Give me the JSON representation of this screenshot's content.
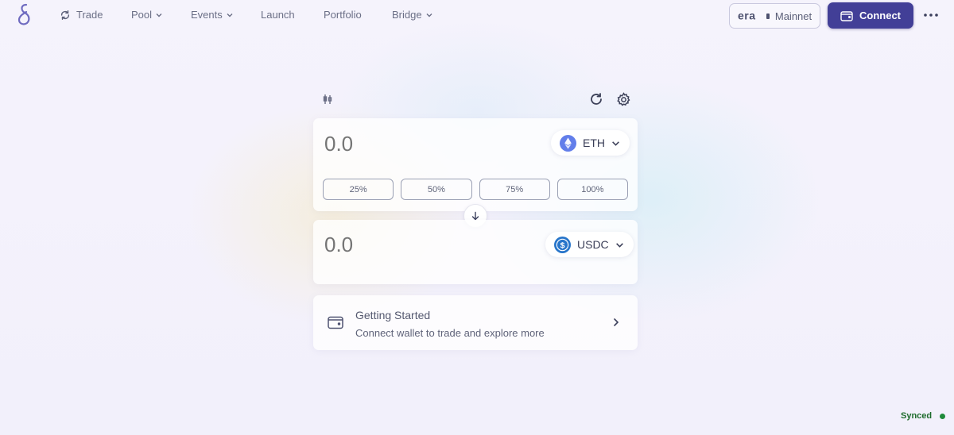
{
  "nav": {
    "items": [
      {
        "label": "Trade",
        "icon": "swap-cycle-icon"
      },
      {
        "label": "Pool",
        "dropdown": true
      },
      {
        "label": "Events",
        "dropdown": true
      },
      {
        "label": "Launch"
      },
      {
        "label": "Portfolio"
      },
      {
        "label": "Bridge",
        "dropdown": true
      }
    ]
  },
  "header": {
    "network_logo_text": "era",
    "network_label": "Mainnet",
    "connect_label": "Connect"
  },
  "swap": {
    "from": {
      "amount": "0.0",
      "token": "ETH",
      "percent_options": [
        "25%",
        "50%",
        "75%",
        "100%"
      ]
    },
    "to": {
      "amount": "0.0",
      "token": "USDC"
    }
  },
  "getting_started": {
    "title": "Getting Started",
    "subtitle": "Connect wallet to trade and explore more"
  },
  "status": {
    "label": "Synced",
    "color": "#1f8a3a"
  },
  "colors": {
    "accent": "#423f97",
    "eth": "#627eea",
    "usdc": "#2775ca"
  }
}
